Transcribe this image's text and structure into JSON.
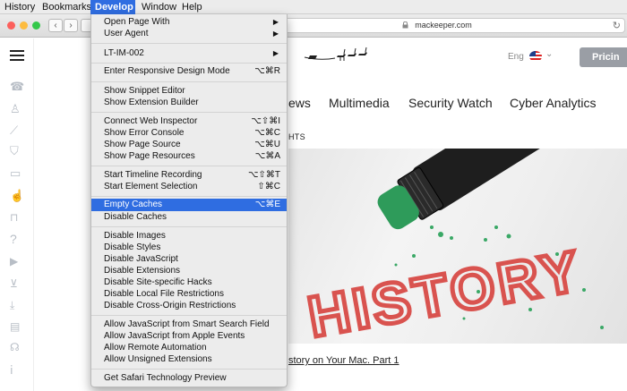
{
  "menubar": {
    "items": [
      {
        "label": "History"
      },
      {
        "label": "Bookmarks"
      },
      {
        "label": "Develop",
        "active": true
      },
      {
        "label": "Window"
      },
      {
        "label": "Help"
      }
    ]
  },
  "toolbar": {
    "url": "mackeeper.com",
    "traffic_light_colors": [
      "#fc605c",
      "#fdbc40",
      "#34c84a"
    ]
  },
  "site": {
    "lang": "Eng",
    "pricing_button": "Pricin",
    "nav": [
      "News",
      "Multimedia",
      "Security Watch",
      "Cyber Analytics"
    ],
    "nav_partial": "ews",
    "sub_nav": "HTS",
    "hero_word": "HISTORY",
    "article_link": "story on Your Mac. Part 1"
  },
  "develop_menu": {
    "items": [
      {
        "label": "Open Page With",
        "submenu": true
      },
      {
        "label": "User Agent",
        "submenu": true
      },
      {
        "separator": true
      },
      {
        "label": "LT-IM-002",
        "submenu": true
      },
      {
        "separator": true
      },
      {
        "label": "Enter Responsive Design Mode",
        "shortcut": "⌥⌘R"
      },
      {
        "separator": true
      },
      {
        "label": "Show Snippet Editor"
      },
      {
        "label": "Show Extension Builder"
      },
      {
        "separator": true
      },
      {
        "label": "Connect Web Inspector",
        "shortcut": "⌥⇧⌘I"
      },
      {
        "label": "Show Error Console",
        "shortcut": "⌥⌘C"
      },
      {
        "label": "Show Page Source",
        "shortcut": "⌥⌘U"
      },
      {
        "label": "Show Page Resources",
        "shortcut": "⌥⌘A"
      },
      {
        "separator": true
      },
      {
        "label": "Start Timeline Recording",
        "shortcut": "⌥⇧⌘T"
      },
      {
        "label": "Start Element Selection",
        "shortcut": "⇧⌘C"
      },
      {
        "separator": true
      },
      {
        "label": "Empty Caches",
        "shortcut": "⌥⌘E",
        "highlighted": true
      },
      {
        "label": "Disable Caches"
      },
      {
        "separator": true
      },
      {
        "label": "Disable Images"
      },
      {
        "label": "Disable Styles"
      },
      {
        "label": "Disable JavaScript"
      },
      {
        "label": "Disable Extensions"
      },
      {
        "label": "Disable Site-specific Hacks"
      },
      {
        "label": "Disable Local File Restrictions"
      },
      {
        "label": "Disable Cross-Origin Restrictions"
      },
      {
        "separator": true
      },
      {
        "label": "Allow JavaScript from Smart Search Field"
      },
      {
        "label": "Allow JavaScript from Apple Events"
      },
      {
        "label": "Allow Remote Automation"
      },
      {
        "label": "Allow Unsigned Extensions"
      },
      {
        "separator": true
      },
      {
        "label": "Get Safari Technology Preview"
      }
    ]
  },
  "rail_icons": [
    "support-icon",
    "user-icon",
    "broom-icon",
    "shield-icon",
    "monitor-icon",
    "hand-icon",
    "lock-icon",
    "question-icon",
    "video-icon",
    "cart-icon",
    "download-icon",
    "card-icon",
    "antivirus-icon",
    "info-icon"
  ],
  "colors": {
    "highlight": "#2f6de1",
    "hero_text": "#d9534f",
    "eraser": "#2e9b5a"
  }
}
